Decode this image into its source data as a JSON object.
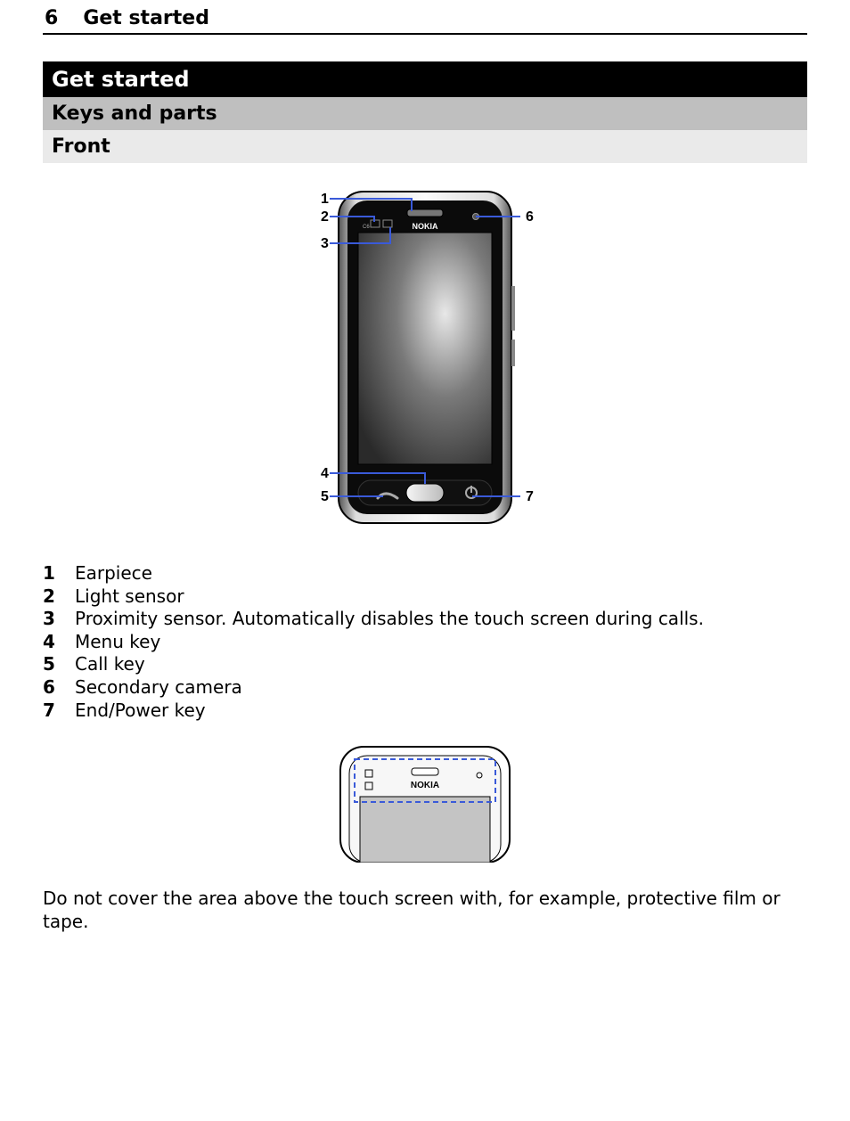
{
  "header": {
    "page_number": "6",
    "running_title": "Get started"
  },
  "section": {
    "title": "Get started",
    "sub1": "Keys and parts",
    "sub2": "Front"
  },
  "brand": "NOKIA",
  "model_tag": "C6",
  "callouts": {
    "n1": "1",
    "n2": "2",
    "n3": "3",
    "n4": "4",
    "n5": "5",
    "n6": "6",
    "n7": "7"
  },
  "legend": [
    {
      "n": "1",
      "t": "Earpiece"
    },
    {
      "n": "2",
      "t": "Light sensor"
    },
    {
      "n": "3",
      "t": "Proximity sensor. Automatically disables the touch screen during calls."
    },
    {
      "n": "4",
      "t": "Menu key"
    },
    {
      "n": "5",
      "t": "Call key"
    },
    {
      "n": "6",
      "t": "Secondary camera"
    },
    {
      "n": "7",
      "t": "End/Power key"
    }
  ],
  "note": "Do not cover the area above the touch screen with, for example, protective film or tape."
}
